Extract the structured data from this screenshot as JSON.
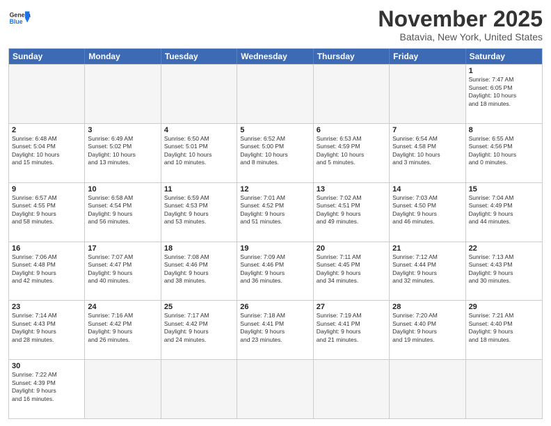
{
  "header": {
    "logo_general": "General",
    "logo_blue": "Blue",
    "month_title": "November 2025",
    "location": "Batavia, New York, United States"
  },
  "days_of_week": [
    "Sunday",
    "Monday",
    "Tuesday",
    "Wednesday",
    "Thursday",
    "Friday",
    "Saturday"
  ],
  "weeks": [
    [
      {
        "day": "",
        "info": "",
        "empty": true
      },
      {
        "day": "",
        "info": "",
        "empty": true
      },
      {
        "day": "",
        "info": "",
        "empty": true
      },
      {
        "day": "",
        "info": "",
        "empty": true
      },
      {
        "day": "",
        "info": "",
        "empty": true
      },
      {
        "day": "",
        "info": "",
        "empty": true
      },
      {
        "day": "1",
        "info": "Sunrise: 7:47 AM\nSunset: 6:05 PM\nDaylight: 10 hours\nand 18 minutes."
      }
    ],
    [
      {
        "day": "2",
        "info": "Sunrise: 6:48 AM\nSunset: 5:04 PM\nDaylight: 10 hours\nand 15 minutes."
      },
      {
        "day": "3",
        "info": "Sunrise: 6:49 AM\nSunset: 5:02 PM\nDaylight: 10 hours\nand 13 minutes."
      },
      {
        "day": "4",
        "info": "Sunrise: 6:50 AM\nSunset: 5:01 PM\nDaylight: 10 hours\nand 10 minutes."
      },
      {
        "day": "5",
        "info": "Sunrise: 6:52 AM\nSunset: 5:00 PM\nDaylight: 10 hours\nand 8 minutes."
      },
      {
        "day": "6",
        "info": "Sunrise: 6:53 AM\nSunset: 4:59 PM\nDaylight: 10 hours\nand 5 minutes."
      },
      {
        "day": "7",
        "info": "Sunrise: 6:54 AM\nSunset: 4:58 PM\nDaylight: 10 hours\nand 3 minutes."
      },
      {
        "day": "8",
        "info": "Sunrise: 6:55 AM\nSunset: 4:56 PM\nDaylight: 10 hours\nand 0 minutes."
      }
    ],
    [
      {
        "day": "9",
        "info": "Sunrise: 6:57 AM\nSunset: 4:55 PM\nDaylight: 9 hours\nand 58 minutes."
      },
      {
        "day": "10",
        "info": "Sunrise: 6:58 AM\nSunset: 4:54 PM\nDaylight: 9 hours\nand 56 minutes."
      },
      {
        "day": "11",
        "info": "Sunrise: 6:59 AM\nSunset: 4:53 PM\nDaylight: 9 hours\nand 53 minutes."
      },
      {
        "day": "12",
        "info": "Sunrise: 7:01 AM\nSunset: 4:52 PM\nDaylight: 9 hours\nand 51 minutes."
      },
      {
        "day": "13",
        "info": "Sunrise: 7:02 AM\nSunset: 4:51 PM\nDaylight: 9 hours\nand 49 minutes."
      },
      {
        "day": "14",
        "info": "Sunrise: 7:03 AM\nSunset: 4:50 PM\nDaylight: 9 hours\nand 46 minutes."
      },
      {
        "day": "15",
        "info": "Sunrise: 7:04 AM\nSunset: 4:49 PM\nDaylight: 9 hours\nand 44 minutes."
      }
    ],
    [
      {
        "day": "16",
        "info": "Sunrise: 7:06 AM\nSunset: 4:48 PM\nDaylight: 9 hours\nand 42 minutes."
      },
      {
        "day": "17",
        "info": "Sunrise: 7:07 AM\nSunset: 4:47 PM\nDaylight: 9 hours\nand 40 minutes."
      },
      {
        "day": "18",
        "info": "Sunrise: 7:08 AM\nSunset: 4:46 PM\nDaylight: 9 hours\nand 38 minutes."
      },
      {
        "day": "19",
        "info": "Sunrise: 7:09 AM\nSunset: 4:46 PM\nDaylight: 9 hours\nand 36 minutes."
      },
      {
        "day": "20",
        "info": "Sunrise: 7:11 AM\nSunset: 4:45 PM\nDaylight: 9 hours\nand 34 minutes."
      },
      {
        "day": "21",
        "info": "Sunrise: 7:12 AM\nSunset: 4:44 PM\nDaylight: 9 hours\nand 32 minutes."
      },
      {
        "day": "22",
        "info": "Sunrise: 7:13 AM\nSunset: 4:43 PM\nDaylight: 9 hours\nand 30 minutes."
      }
    ],
    [
      {
        "day": "23",
        "info": "Sunrise: 7:14 AM\nSunset: 4:43 PM\nDaylight: 9 hours\nand 28 minutes."
      },
      {
        "day": "24",
        "info": "Sunrise: 7:16 AM\nSunset: 4:42 PM\nDaylight: 9 hours\nand 26 minutes."
      },
      {
        "day": "25",
        "info": "Sunrise: 7:17 AM\nSunset: 4:42 PM\nDaylight: 9 hours\nand 24 minutes."
      },
      {
        "day": "26",
        "info": "Sunrise: 7:18 AM\nSunset: 4:41 PM\nDaylight: 9 hours\nand 23 minutes."
      },
      {
        "day": "27",
        "info": "Sunrise: 7:19 AM\nSunset: 4:41 PM\nDaylight: 9 hours\nand 21 minutes."
      },
      {
        "day": "28",
        "info": "Sunrise: 7:20 AM\nSunset: 4:40 PM\nDaylight: 9 hours\nand 19 minutes."
      },
      {
        "day": "29",
        "info": "Sunrise: 7:21 AM\nSunset: 4:40 PM\nDaylight: 9 hours\nand 18 minutes."
      }
    ],
    [
      {
        "day": "30",
        "info": "Sunrise: 7:22 AM\nSunset: 4:39 PM\nDaylight: 9 hours\nand 16 minutes."
      },
      {
        "day": "",
        "info": "",
        "empty": true
      },
      {
        "day": "",
        "info": "",
        "empty": true
      },
      {
        "day": "",
        "info": "",
        "empty": true
      },
      {
        "day": "",
        "info": "",
        "empty": true
      },
      {
        "day": "",
        "info": "",
        "empty": true
      },
      {
        "day": "",
        "info": "",
        "empty": true
      }
    ]
  ]
}
